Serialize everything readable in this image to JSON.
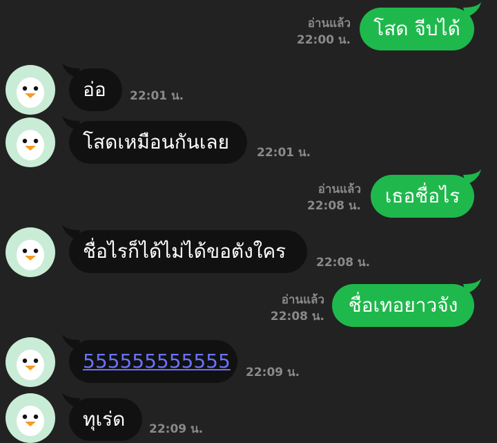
{
  "messages": [
    {
      "dir": "out",
      "text": "โสด จีบได้",
      "read": "อ่านแล้ว",
      "time": "22:00 น."
    },
    {
      "dir": "in",
      "text": "อ่อ",
      "time": "22:01 น."
    },
    {
      "dir": "in",
      "text": "โสดเหมือนกันเลย",
      "time": "22:01 น."
    },
    {
      "dir": "out",
      "text": "เธอชื่อไร",
      "read": "อ่านแล้ว",
      "time": "22:08 น."
    },
    {
      "dir": "in",
      "text": "ชื่อไรก็ได้ไม่ได้ขอตังใคร",
      "time": "22:08 น."
    },
    {
      "dir": "out",
      "text": "ชื่อเทอยาวจัง",
      "read": "อ่านแล้ว",
      "time": "22:08 น."
    },
    {
      "dir": "in",
      "text": "555555555555",
      "time": "22:09 น.",
      "link": true
    },
    {
      "dir": "in",
      "text": "ทุเร่ด",
      "time": "22:09 น."
    }
  ],
  "colors": {
    "outgoing_bubble": "#1fb84c",
    "incoming_bubble": "#111111",
    "link": "#6a72ff"
  },
  "avatar_icon": "penguin-icon"
}
